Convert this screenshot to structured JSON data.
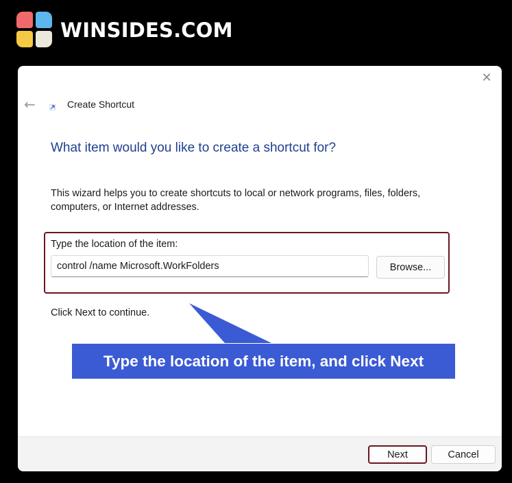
{
  "brand": {
    "name": "WINSIDES.COM",
    "logo_colors": [
      "#ef6b6b",
      "#5db7ee",
      "#f6c945",
      "#ece8dc"
    ]
  },
  "dialog": {
    "title": "Create Shortcut",
    "close_icon": "close-icon",
    "back_icon": "back-arrow-icon",
    "heading": "What item would you like to create a shortcut for?",
    "description": "This wizard helps you to create shortcuts to local or network programs, files, folders, computers, or Internet addresses.",
    "location_label": "Type the location of the item:",
    "location_value": "control /name Microsoft.WorkFolders",
    "browse_label": "Browse...",
    "continue_text": "Click Next to continue.",
    "next_label": "Next",
    "cancel_label": "Cancel"
  },
  "annotation": {
    "text": "Type the location of the item, and click Next",
    "color": "#3b5bd4",
    "highlight_color": "#6b1520"
  }
}
